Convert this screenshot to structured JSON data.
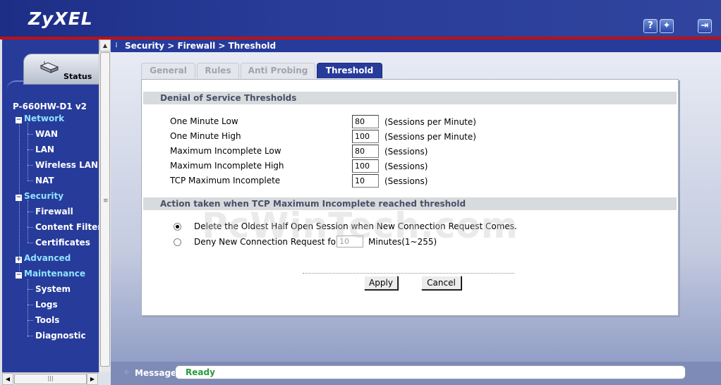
{
  "header": {
    "logo": "ZyXEL",
    "icons": [
      {
        "name": "help-icon",
        "glyph": "?"
      },
      {
        "name": "wizard-icon",
        "glyph": "✦"
      },
      {
        "name": "logout-icon",
        "glyph": "⇥"
      }
    ]
  },
  "sidebar": {
    "status_label": "Status",
    "model": "P-660HW-D1 v2",
    "sections": [
      {
        "label": "Network",
        "expanded": true,
        "items": [
          "WAN",
          "LAN",
          "Wireless LAN",
          "NAT"
        ]
      },
      {
        "label": "Security",
        "expanded": true,
        "items": [
          "Firewall",
          "Content Filter",
          "Certificates"
        ]
      },
      {
        "label": "Advanced",
        "expanded": false,
        "items": []
      },
      {
        "label": "Maintenance",
        "expanded": true,
        "items": [
          "System",
          "Logs",
          "Tools",
          "Diagnostic"
        ]
      }
    ]
  },
  "breadcrumb": "Security > Firewall > Threshold",
  "tabs": [
    {
      "label": "General",
      "active": false
    },
    {
      "label": "Rules",
      "active": false
    },
    {
      "label": "Anti Probing",
      "active": false
    },
    {
      "label": "Threshold",
      "active": true
    }
  ],
  "dos": {
    "title": "Denial of Service Thresholds",
    "fields": [
      {
        "label": "One Minute Low",
        "value": "80",
        "unit": "(Sessions per Minute)"
      },
      {
        "label": "One Minute High",
        "value": "100",
        "unit": "(Sessions per Minute)"
      },
      {
        "label": "Maximum Incomplete Low",
        "value": "80",
        "unit": "(Sessions)"
      },
      {
        "label": "Maximum Incomplete High",
        "value": "100",
        "unit": "(Sessions)"
      },
      {
        "label": "TCP Maximum Incomplete",
        "value": "10",
        "unit": "(Sessions)"
      }
    ]
  },
  "action": {
    "title": "Action taken when TCP Maximum Incomplete reached threshold",
    "option1": "Delete the Oldest Half Open Session when New Connection Request Comes.",
    "option2_prefix": "Deny New Connection Request for",
    "option2_value": "10",
    "option2_suffix": "Minutes(1~255)",
    "selected": 1
  },
  "buttons": {
    "apply": "Apply",
    "cancel": "Cancel"
  },
  "watermark": "PcWinTech.com",
  "statusbar": {
    "label": "Message",
    "text": "Ready"
  },
  "colors": {
    "header_blue": "#283c98",
    "accent_red": "#c01010",
    "nav_section": "#8fe3ff",
    "status_ok": "#2a9a3a"
  }
}
